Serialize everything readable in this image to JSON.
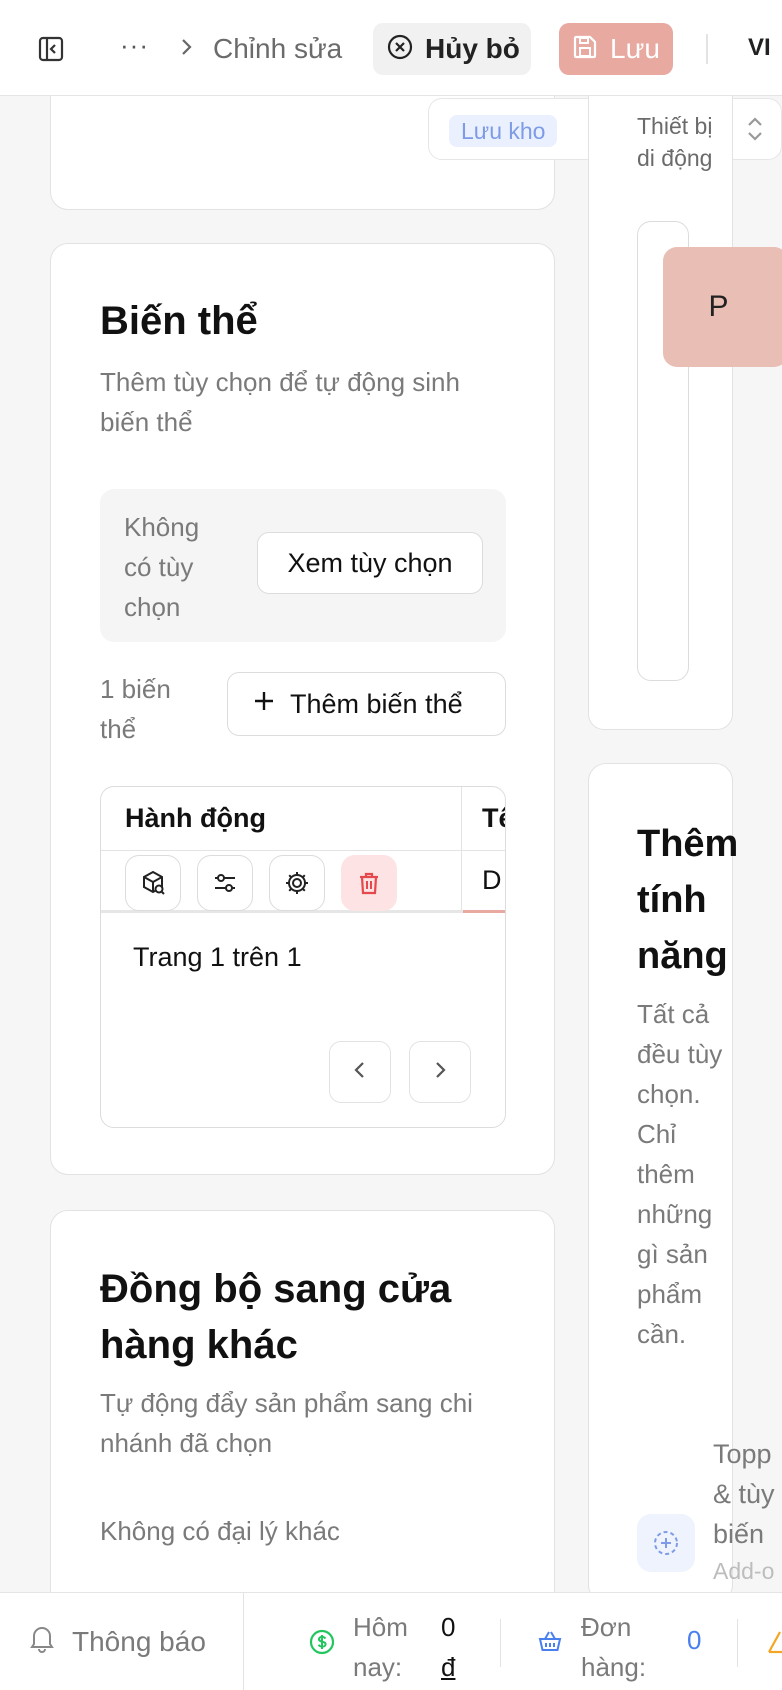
{
  "header": {
    "more": "···",
    "breadcrumb": "Chỉnh sửa",
    "cancel_label": "Hủy bỏ",
    "save_label": "Lưu",
    "language": "VI"
  },
  "variants": {
    "title": "Biến thể",
    "description": "Thêm tùy chọn để tự động sinh biến thể",
    "options_empty": "Không có tùy chọn",
    "view_options_label": "Xem tùy chọn",
    "count_text": "1 biến thể",
    "add_variant_label": "Thêm biến thể",
    "table": {
      "columns": [
        "Hành động",
        "Tê"
      ],
      "rows": [
        {
          "second_cell": "D"
        }
      ],
      "pagination_text": "Trang 1 trên 1"
    }
  },
  "sync": {
    "title": "Đồng bộ sang cửa hàng khác",
    "description": "Tự động đẩy sản phẩm sang chi nhánh đã chọn",
    "empty": "Không có đại lý khác"
  },
  "inventory": {
    "chip_label": "Lưu kho"
  },
  "device_preview": {
    "label": "Thiết bị di động",
    "tile_text": "P"
  },
  "features": {
    "title": "Thêm tính năng",
    "description": "Tất cả đều tùy chọn. Chỉ thêm những gì sản phẩm cần.",
    "addon_title": "Topp & tùy biến",
    "addon_sub": "Add-o"
  },
  "footer": {
    "notifications_label": "Thông báo",
    "today_label": "Hôm nay:",
    "today_value": "0",
    "today_currency": "đ",
    "orders_label": "Đơn hàng:",
    "orders_value": "0"
  },
  "colors": {
    "accent_save": "#e8a9a0",
    "danger": "#e5484d",
    "money_green": "#22c55e",
    "link_blue": "#4a7ff0",
    "warning": "#f5a524"
  }
}
